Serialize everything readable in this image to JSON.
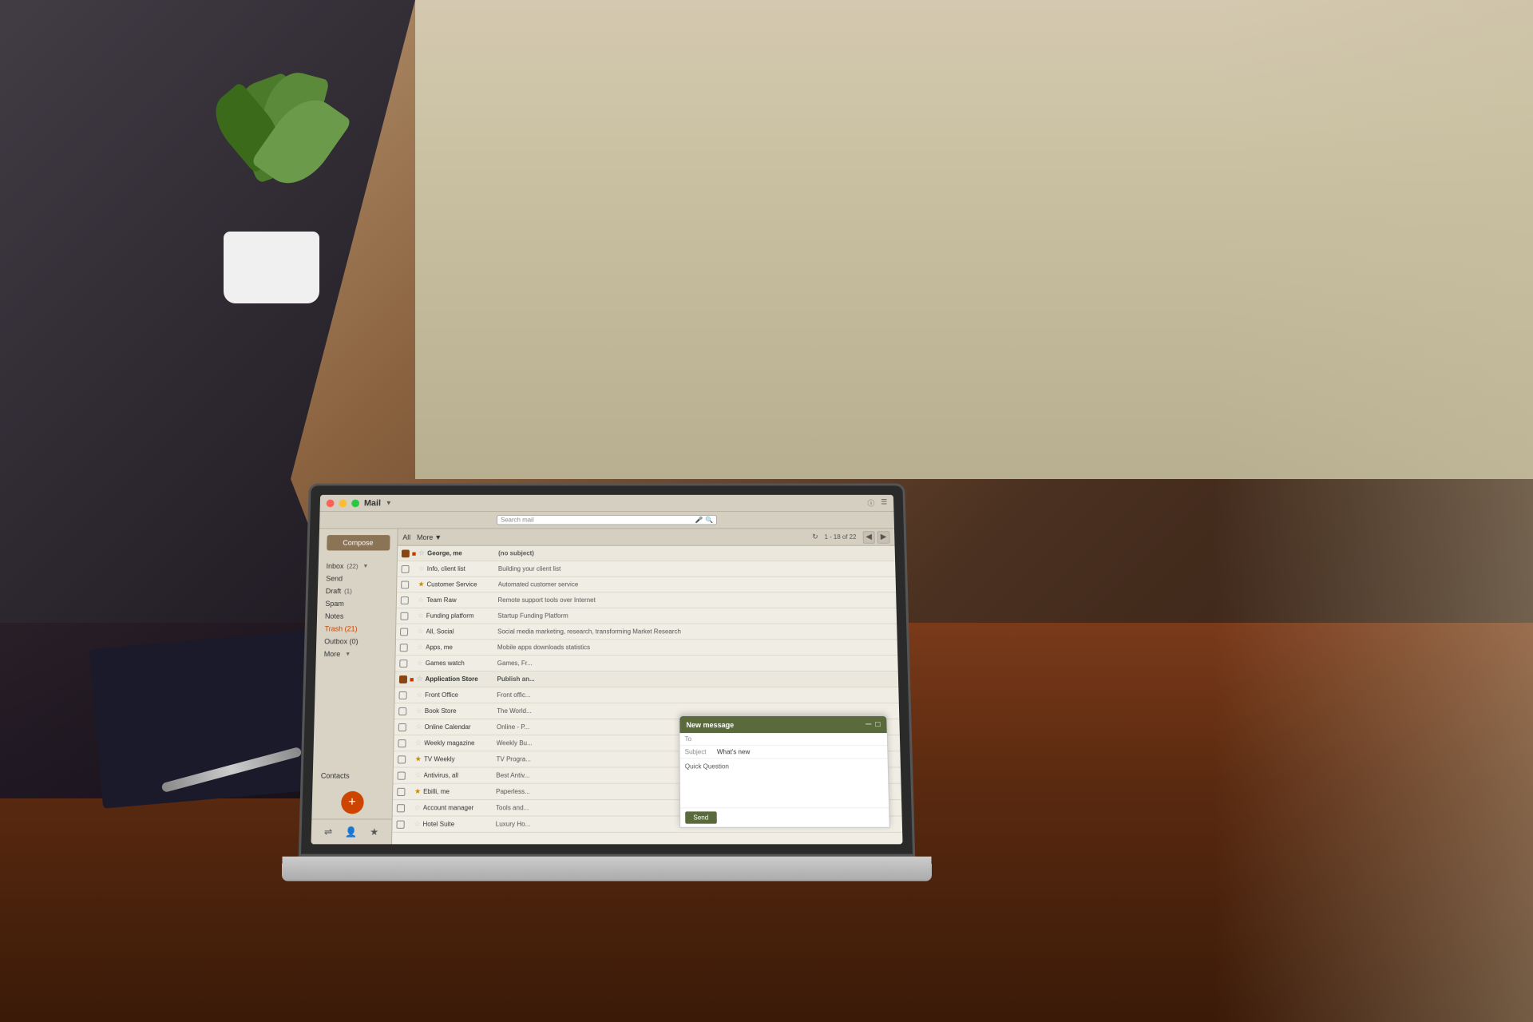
{
  "app": {
    "title": "Mail",
    "search_placeholder": "Search mail",
    "window_buttons": [
      "close",
      "minimize",
      "maximize"
    ]
  },
  "toolbar": {
    "all_label": "All",
    "more_label": "More",
    "refresh_icon": "↻",
    "count": "1 - 18 of 22",
    "prev_icon": "◀",
    "next_icon": "▶",
    "info_icon": "ⓘ",
    "menu_icon": "☰"
  },
  "sidebar": {
    "compose_label": "Compose",
    "items": [
      {
        "id": "inbox",
        "label": "Inbox",
        "badge": "(22)",
        "arrow": "▼"
      },
      {
        "id": "send",
        "label": "Send"
      },
      {
        "id": "draft",
        "label": "Draft",
        "badge": "(1)"
      },
      {
        "id": "spam",
        "label": "Spam"
      },
      {
        "id": "notes",
        "label": "Notes"
      },
      {
        "id": "trash",
        "label": "Trash (21)",
        "is_trash": true
      },
      {
        "id": "outbox",
        "label": "Outbox (0)"
      },
      {
        "id": "more",
        "label": "More",
        "arrow": "▼"
      }
    ],
    "contacts_label": "Contacts",
    "fab_icon": "+",
    "footer_icons": [
      "≡",
      "👤",
      "★"
    ]
  },
  "emails": [
    {
      "checked": true,
      "star": "important",
      "from": "George, me",
      "subject": "(no subject)"
    },
    {
      "checked": false,
      "star": "none",
      "from": "Info, client list",
      "subject": "Building your client list"
    },
    {
      "checked": false,
      "star": "starred",
      "from": "Customer Service",
      "subject": "Automated customer service"
    },
    {
      "checked": false,
      "star": "none",
      "from": "Team Raw",
      "subject": "Remote support tools over Internet"
    },
    {
      "checked": false,
      "star": "none",
      "from": "Funding platform",
      "subject": "Startup Funding Platform"
    },
    {
      "checked": false,
      "star": "none",
      "from": "All, Social",
      "subject": "Social media marketing, research, transforming Market Research"
    },
    {
      "checked": false,
      "star": "none",
      "from": "Apps, me",
      "subject": "Mobile apps downloads statistics"
    },
    {
      "checked": false,
      "star": "none",
      "from": "Games watch",
      "subject": "Games, Fr..."
    },
    {
      "checked": true,
      "star": "important",
      "from": "Application Store",
      "subject": "Publish an..."
    },
    {
      "checked": false,
      "star": "none",
      "from": "Front Office",
      "subject": "Front offic..."
    },
    {
      "checked": false,
      "star": "none",
      "from": "Book Store",
      "subject": "The World..."
    },
    {
      "checked": false,
      "star": "none",
      "from": "Online Calendar",
      "subject": "Online - P..."
    },
    {
      "checked": false,
      "star": "none",
      "from": "Weekly magazine",
      "subject": "Weekly Bu..."
    },
    {
      "checked": false,
      "star": "starred",
      "from": "TV Weekly",
      "subject": "TV Progra..."
    },
    {
      "checked": false,
      "star": "none",
      "from": "Antivirus, all",
      "subject": "Best Antiv..."
    },
    {
      "checked": false,
      "star": "starred",
      "from": "Ebilli, me",
      "subject": "Paperless..."
    },
    {
      "checked": false,
      "star": "none",
      "from": "Account manager",
      "subject": "Tools and..."
    },
    {
      "checked": false,
      "star": "none",
      "from": "Hotel Suite",
      "subject": "Luxury Ho..."
    }
  ],
  "compose": {
    "header_title": "New message",
    "minimize_icon": "─",
    "expand_icon": "□",
    "to_label": "To",
    "to_value": "",
    "subject_label": "Subject",
    "subject_value": "What's new",
    "quick_question": "Quick Question",
    "send_label": "Send"
  }
}
